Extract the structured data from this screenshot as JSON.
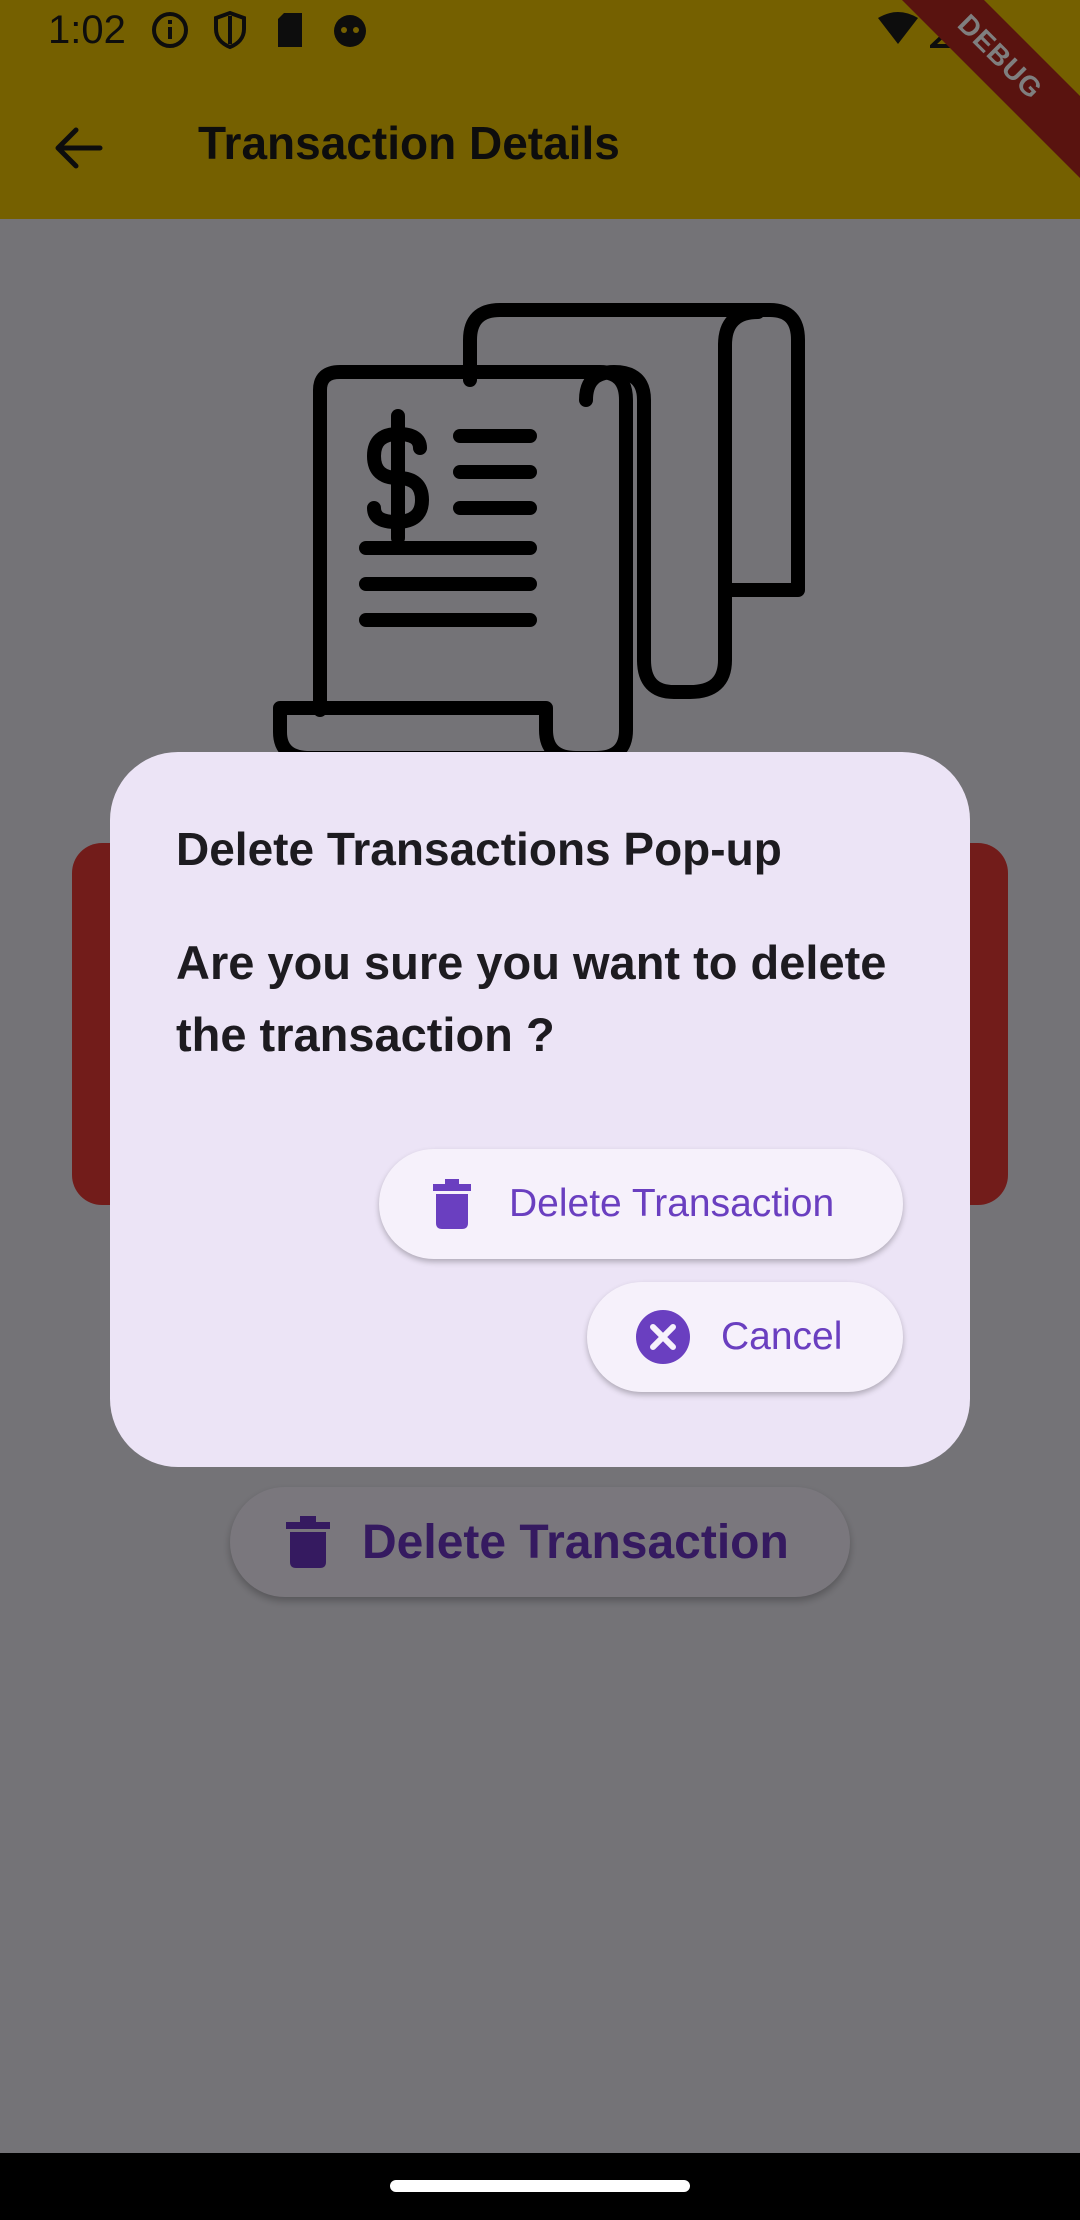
{
  "status_bar": {
    "time": "1:02",
    "left_icons": [
      "info-icon",
      "shield-icon",
      "sd-card-icon",
      "robot-face-icon"
    ],
    "right_icons": [
      "wifi-icon",
      "signal-icon",
      "battery-icon"
    ]
  },
  "app_bar": {
    "title": "Transaction Details",
    "back_icon": "arrow-back-icon",
    "background_color": "#EBC000"
  },
  "debug_banner": {
    "label": "DEBUG"
  },
  "page": {
    "illustration": "receipt-dollar-icon",
    "card_color": "#E53935",
    "delete_button_label": "Delete Transaction"
  },
  "dialog": {
    "title": "Delete Transactions Pop-up",
    "message": "Are you sure you want to delete the transaction ?",
    "delete_button_label": "Delete Transaction",
    "cancel_button_label": "Cancel",
    "accent_color": "#6A3FC0"
  }
}
